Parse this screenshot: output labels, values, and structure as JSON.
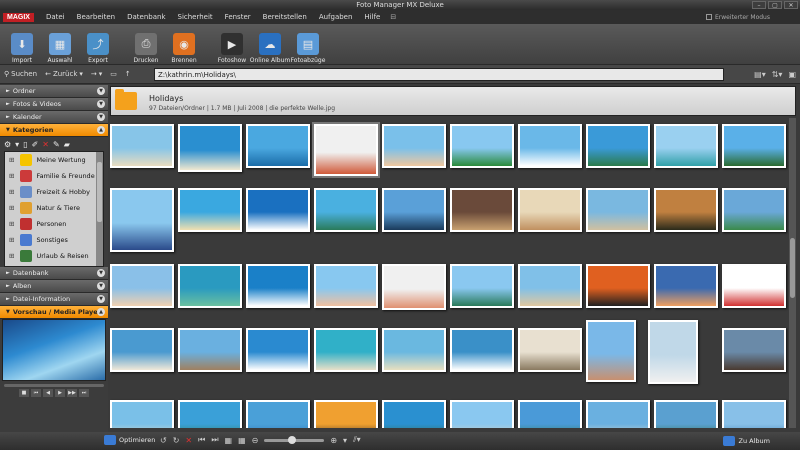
{
  "window": {
    "title": "Foto Manager MX Deluxe",
    "min": "–",
    "max": "▢",
    "close": "✕"
  },
  "menu": {
    "logo": "MAGIX",
    "items": [
      {
        "label": "Datei",
        "underline": "D"
      },
      {
        "label": "Bearbeiten",
        "underline": "B"
      },
      {
        "label": "Datenbank",
        "underline": "D"
      },
      {
        "label": "Sicherheit",
        "underline": "S"
      },
      {
        "label": "Fenster",
        "underline": "F"
      },
      {
        "label": "Bereitstellen",
        "underline": "B"
      },
      {
        "label": "Aufgaben",
        "underline": ""
      },
      {
        "label": "Hilfe",
        "underline": "H"
      }
    ],
    "expert_mode": "Erweiterter Modus"
  },
  "toolbar": [
    {
      "label": "Import",
      "color": "#5a8cc8",
      "glyph": "⬇"
    },
    {
      "label": "Auswahl",
      "color": "#6aa0d8",
      "glyph": "▦"
    },
    {
      "label": "Export",
      "color": "#4a90c8",
      "glyph": "⤴"
    },
    {
      "label": "Drucken",
      "color": "#707070",
      "glyph": "⎙"
    },
    {
      "label": "Brennen",
      "color": "#e07020",
      "glyph": "◉"
    },
    {
      "label": "Fotoshow",
      "color": "#303030",
      "glyph": "▶"
    },
    {
      "label": "Online Album",
      "color": "#2a70c0",
      "glyph": "☁"
    },
    {
      "label": "Fotoabzüge",
      "color": "#5a9ad8",
      "glyph": "▤"
    }
  ],
  "nav": {
    "search": "Suchen",
    "back": "Zurück",
    "path": "Z:\\kathrin.m\\Holidays\\"
  },
  "left": {
    "sections_top": [
      "Ordner",
      "Fotos & Videos",
      "Kalender"
    ],
    "active_section": "Kategorien",
    "categories": [
      {
        "label": "Meine Wertung",
        "color": "#f5c400"
      },
      {
        "label": "Familie & Freunde",
        "color": "#cc3a3a"
      },
      {
        "label": "Freizeit & Hobby",
        "color": "#6a8ec8"
      },
      {
        "label": "Natur & Tiere",
        "color": "#e0a030"
      },
      {
        "label": "Personen",
        "color": "#c03030"
      },
      {
        "label": "Sonstiges",
        "color": "#4a7ad0"
      },
      {
        "label": "Urlaub & Reisen",
        "color": "#3a7a3a"
      }
    ],
    "sections_bottom": [
      "Datenbank",
      "Alben",
      "Datei-Information"
    ],
    "preview_section": "Vorschau / Media Player"
  },
  "folder": {
    "name": "Holidays",
    "info": "97 Dateien/Ordner | 1.7 MB | Juli 2008 | die perfekte Welle.jpg"
  },
  "thumbnails": {
    "palettes": [
      [
        "#87c5e8",
        "#e8dcc0"
      ],
      [
        "#2a8fd0",
        "#f0e8d0"
      ],
      [
        "#4aa8e0",
        "#1a6ca8"
      ],
      [
        "#f0f0f0",
        "#d05a3a"
      ],
      [
        "#7ac0ea",
        "#f0c8a0"
      ],
      [
        "#88c8f0",
        "#2a8a3a"
      ],
      [
        "#6ab8e8",
        "#ffffff"
      ],
      [
        "#3a9ad8",
        "#2a7a4a"
      ],
      [
        "#9ad0f0",
        "#30a0a8"
      ],
      [
        "#5ab0e8",
        "#2a6a30"
      ],
      [
        "#8ac8ee",
        "#2a4a8a"
      ],
      [
        "#3aa8e0",
        "#f0e0b0"
      ],
      [
        "#1a70c0",
        "#ffffff"
      ],
      [
        "#4ab0e0",
        "#2a7a5a"
      ],
      [
        "#5aa0d8",
        "#1a3a5a"
      ],
      [
        "#6a4a3a",
        "#c8a070"
      ],
      [
        "#e8d8b8",
        "#c09060"
      ],
      [
        "#7ab8e0",
        "#d0c0a0"
      ],
      [
        "#c08040",
        "#2a2a1a"
      ],
      [
        "#6aa8d8",
        "#3a8a4a"
      ],
      [
        "#8ac0e8",
        "#f0d0b0"
      ],
      [
        "#2a9ac0",
        "#6ac0a0"
      ],
      [
        "#1a80c8",
        "#ffffff"
      ],
      [
        "#88c8f0",
        "#f0c0a0"
      ],
      [
        "#f0f0f0",
        "#e09070"
      ],
      [
        "#8ac8f0",
        "#2a7a5a"
      ],
      [
        "#80c0e8",
        "#e0c8a0"
      ],
      [
        "#e06020",
        "#202020"
      ],
      [
        "#3a6ab0",
        "#f0a060"
      ],
      [
        "#ffffff",
        "#d03030"
      ],
      [
        "#4a9ad0",
        "#f0e8d8"
      ],
      [
        "#6ab0e0",
        "#a08060"
      ],
      [
        "#2a8ad0",
        "#ffffff"
      ],
      [
        "#30b0c8",
        "#e8e0c8"
      ],
      [
        "#6ab8e0",
        "#e8e0c0"
      ],
      [
        "#3a90c8",
        "#ffffff"
      ],
      [
        "#e8e0d0",
        "#8a7a60"
      ],
      [
        "#7ab8e8",
        "#c89070"
      ],
      [
        "#c0d8e8",
        "#f0f0f0"
      ],
      [
        "#6a8aa8",
        "#4a3a30"
      ],
      [
        "#7ac0e8",
        "#f0e0c0"
      ],
      [
        "#3aa0d8",
        "#2a7a4a"
      ],
      [
        "#4aa0d8",
        "#2a6ab0"
      ],
      [
        "#f0a030",
        "#202020"
      ],
      [
        "#2a90d0",
        "#3a6a3a"
      ],
      [
        "#8ac8f0",
        "#e8d0b0"
      ],
      [
        "#4a9ad8",
        "#2a7a4a"
      ],
      [
        "#6ab0e0",
        "#f0e0c0"
      ],
      [
        "#5aa0d0",
        "#2a6a3a"
      ],
      [
        "#88c0e8",
        "#3a7aa8"
      ]
    ]
  },
  "status": {
    "optimize": "Optimieren",
    "to_album": "Zu Album"
  }
}
